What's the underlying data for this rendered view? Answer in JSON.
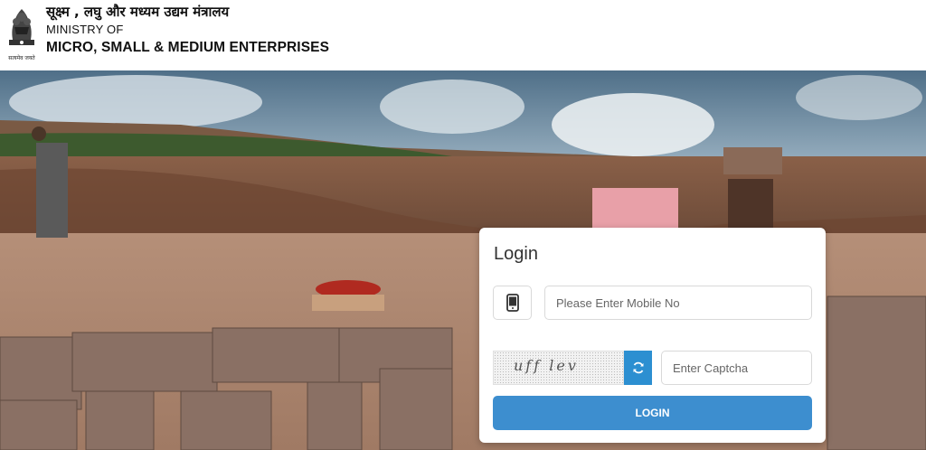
{
  "header": {
    "hindi_title": "सूक्ष्म , लघु और मध्यम उद्यम मंत्रालय",
    "ministry_of": "MINISTRY OF",
    "ministry_name": "MICRO, SMALL & MEDIUM ENTERPRISES",
    "emblem_caption": "सत्यमेव जयते"
  },
  "login": {
    "title": "Login",
    "mobile_placeholder": "Please Enter Mobile No",
    "mobile_icon": "mobile-phone-icon",
    "captcha_text": "uff lev",
    "refresh_icon": "refresh-icon",
    "captcha_placeholder": "Enter Captcha",
    "login_label": "LOGIN"
  },
  "colors": {
    "primary_blue": "#3d8ecf",
    "refresh_blue": "#2c8fd1"
  }
}
